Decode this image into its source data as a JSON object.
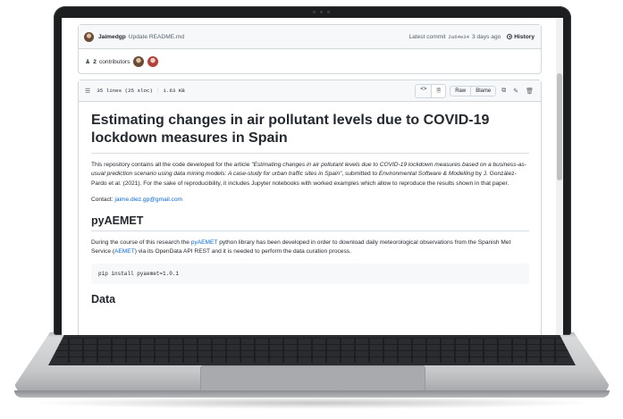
{
  "commit": {
    "author": "Jaimedgp",
    "message": "Update README.md",
    "latest_label": "Latest commit",
    "sha": "2a64e34",
    "age": "3 days ago",
    "history_label": "History"
  },
  "contributors": {
    "count": "2",
    "label": "contributors"
  },
  "file": {
    "lines": "35 lines (25 sloc)",
    "size": "1.63 KB",
    "raw_label": "Raw",
    "blame_label": "Blame"
  },
  "readme": {
    "title": "Estimating changes in air pollutant levels due to COVID-19 lockdown measures in Spain",
    "intro_1": "This repository contains all the code developed for the article ",
    "intro_article": "\"Estimating changes in air pollutant levels due to COVID-19 lockdown measures based on a business-as-usual prediction scenario using data mining models: A case-study for urban traffic sites in Spain\"",
    "intro_2": ", submitted to ",
    "intro_journal": "Environmental Software & Modelling",
    "intro_3": " by J. González-Pardo et al. (2021). For the sake of reproducibility, it includes Jupyter notebooks with worked examples which allow to reproduce the results shown in that paper.",
    "contact_label": "Contact: ",
    "contact_email": "jaime.diez.gp@gmail.com",
    "h2_pyaemet": "pyAEMET",
    "py_1": "During the course of this research the ",
    "py_link": "pyAEMET",
    "py_2": " python library has been developed in order to download daily meteorological observations from the Spanish Met Service (",
    "py_aemet": "AEMET",
    "py_3": ") via its OpenData API REST and it is needed to perform the data curation process.",
    "install_cmd": "pip install pyaemet=1.0.1",
    "h2_data": "Data"
  },
  "icons": {
    "people": "people-icon",
    "list": "list-icon",
    "code": "code-icon",
    "file": "file-icon",
    "copy": "copy-icon",
    "edit": "pencil-icon",
    "delete": "trash-icon",
    "history": "clock-icon"
  },
  "colors": {
    "link": "#0969da",
    "text": "#24292f",
    "muted": "#57606a",
    "border": "#d0d7de",
    "laptop_bezel": "#1d1e20"
  }
}
